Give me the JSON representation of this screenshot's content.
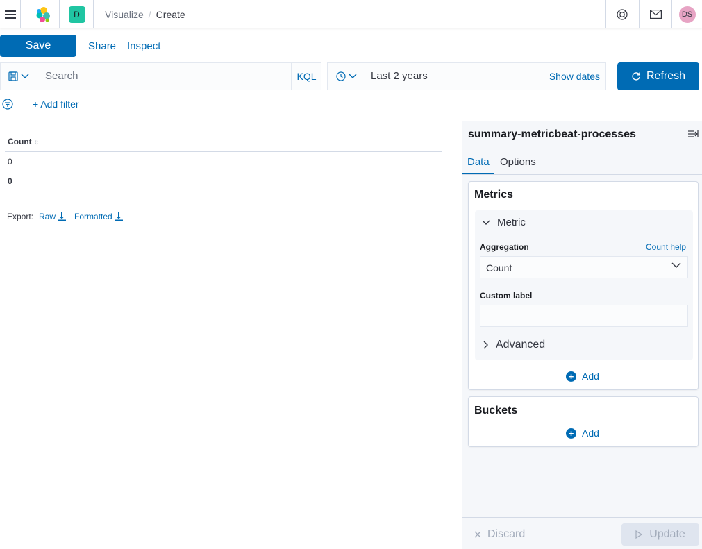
{
  "header": {
    "breadcrumbs": [
      "Visualize",
      "Create"
    ],
    "breadcrumb_sep": "/",
    "space_initial": "D",
    "user_initials": "DS",
    "icons": [
      "menu-icon",
      "elastic-logo-icon",
      "help-icon",
      "mail-icon"
    ]
  },
  "toolbar": {
    "save_label": "Save",
    "share_label": "Share",
    "inspect_label": "Inspect"
  },
  "query": {
    "search_placeholder": "Search",
    "language": "KQL",
    "time_range": "Last 2 years",
    "show_dates_label": "Show dates",
    "refresh_label": "Refresh"
  },
  "filter": {
    "add_filter_label": "+ Add filter"
  },
  "table": {
    "column": "Count",
    "rows": [
      "0"
    ],
    "total": "0",
    "export_label": "Export:",
    "export_raw": "Raw",
    "export_formatted": "Formatted"
  },
  "sidebar": {
    "title": "summary-metricbeat-processes",
    "tabs": [
      "Data",
      "Options"
    ],
    "active_tab": "Data",
    "metrics": {
      "title": "Metrics",
      "item_label": "Metric",
      "aggregation_label": "Aggregation",
      "aggregation_help": "Count help",
      "aggregation_value": "Count",
      "custom_label_label": "Custom label",
      "custom_label_value": "",
      "advanced_label": "Advanced",
      "add_label": "Add"
    },
    "buckets": {
      "title": "Buckets",
      "add_label": "Add"
    },
    "discard_label": "Discard",
    "update_label": "Update"
  },
  "colors": {
    "primary": "#006bb4",
    "space_badge": "#20c5a2",
    "avatar": "#e7a4c4",
    "text": "#343741",
    "disabled": "#a2abba"
  }
}
